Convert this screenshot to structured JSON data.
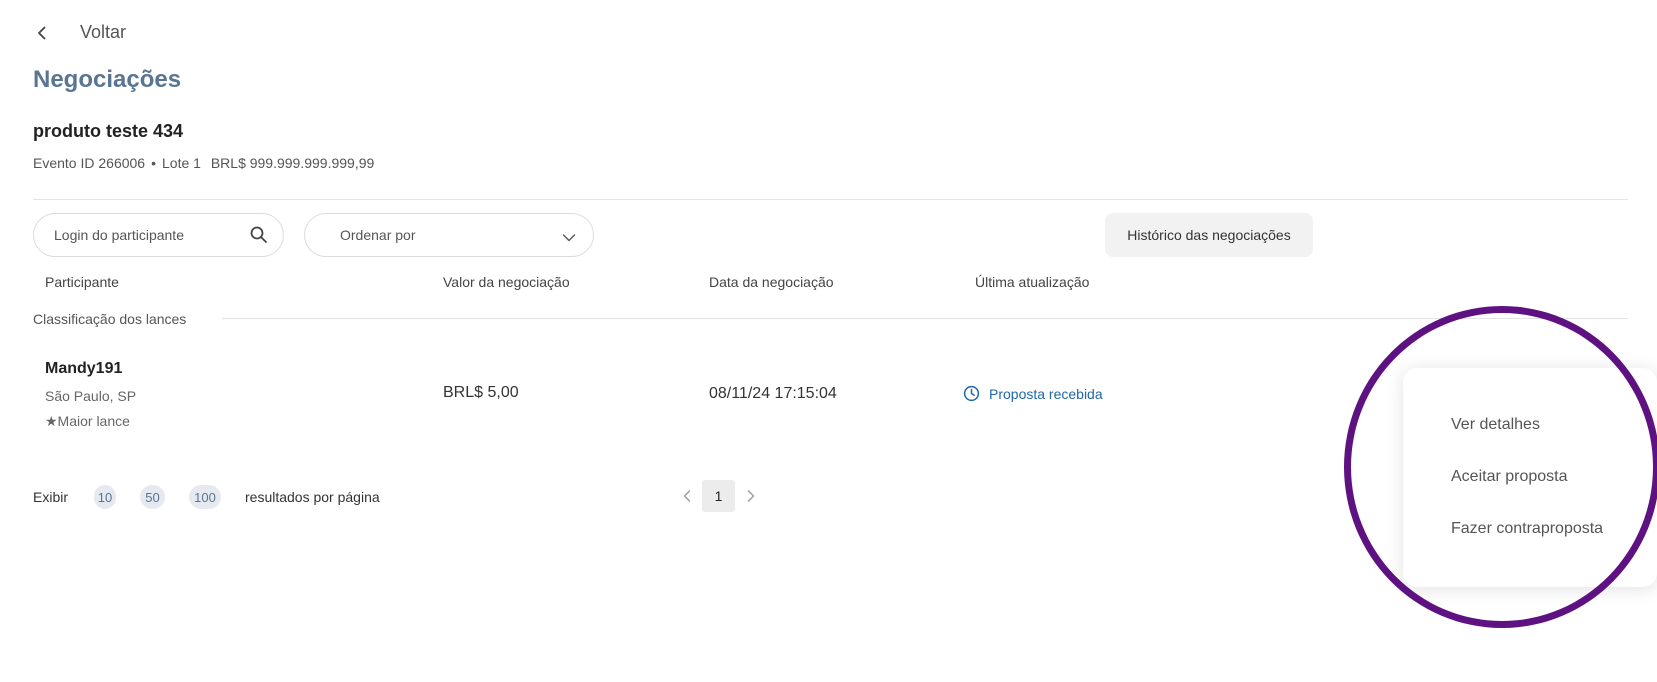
{
  "header": {
    "back_label": "Voltar",
    "title": "Negociações"
  },
  "product": {
    "name": "produto teste 434",
    "event": "Evento ID 266006",
    "separator": "•",
    "lot": "Lote 1",
    "price": "BRL$ 999.999.999.999,99"
  },
  "toolbar": {
    "search_placeholder": "Login do participante",
    "sort_placeholder": "Ordenar por",
    "history_label": "Histórico das negociações"
  },
  "table": {
    "columns": [
      "Participante",
      "Valor da negociação",
      "Data da negociação",
      "Última atualização"
    ],
    "group_label": "Classificação dos lances",
    "rows": [
      {
        "participant": "Mandy191",
        "location": "São Paulo, SP",
        "badge": "★Maior lance",
        "value": "BRL$ 5,00",
        "date": "08/11/24 17:15:04",
        "status": "Proposta recebida"
      }
    ]
  },
  "pagination": {
    "show_label": "Exibir",
    "sizes": [
      "10",
      "50",
      "100"
    ],
    "per_page_label": "resultados por página",
    "current_page": "1"
  },
  "context_menu": {
    "items": [
      "Ver detalhes",
      "Aceitar proposta",
      "Fazer contraproposta"
    ]
  },
  "colors": {
    "title": "#5a7593",
    "status": "#1f67a8",
    "highlight": "#5e1282"
  },
  "icons": {
    "back": "chevron-left-icon",
    "search": "search-icon",
    "sort": "chevron-down-icon",
    "status": "clock-icon",
    "prev": "chevron-left-icon",
    "next": "chevron-right-icon"
  }
}
